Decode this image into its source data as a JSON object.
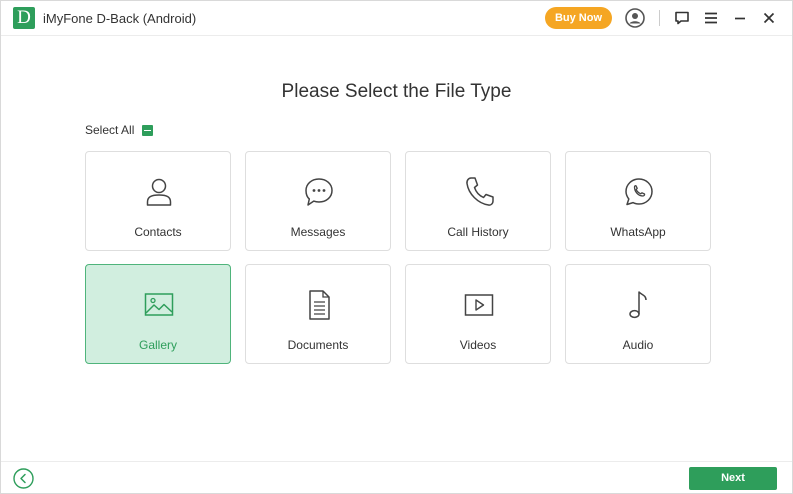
{
  "app": {
    "logo_letter": "D",
    "title": "iMyFone D-Back (Android)",
    "buy_now": "Buy Now"
  },
  "main": {
    "heading": "Please Select the File Type",
    "select_all": "Select All",
    "tiles": [
      {
        "label": "Contacts",
        "icon": "person-icon",
        "selected": false
      },
      {
        "label": "Messages",
        "icon": "chat-bubble-icon",
        "selected": false
      },
      {
        "label": "Call History",
        "icon": "phone-icon",
        "selected": false
      },
      {
        "label": "WhatsApp",
        "icon": "whatsapp-icon",
        "selected": false
      },
      {
        "label": "Gallery",
        "icon": "image-icon",
        "selected": true
      },
      {
        "label": "Documents",
        "icon": "document-icon",
        "selected": false
      },
      {
        "label": "Videos",
        "icon": "video-play-icon",
        "selected": false
      },
      {
        "label": "Audio",
        "icon": "music-note-icon",
        "selected": false
      }
    ]
  },
  "footer": {
    "next": "Next"
  },
  "colors": {
    "accent": "#2e9e5b",
    "buy_now": "#f5a623",
    "selected_bg": "#d1eedf"
  }
}
